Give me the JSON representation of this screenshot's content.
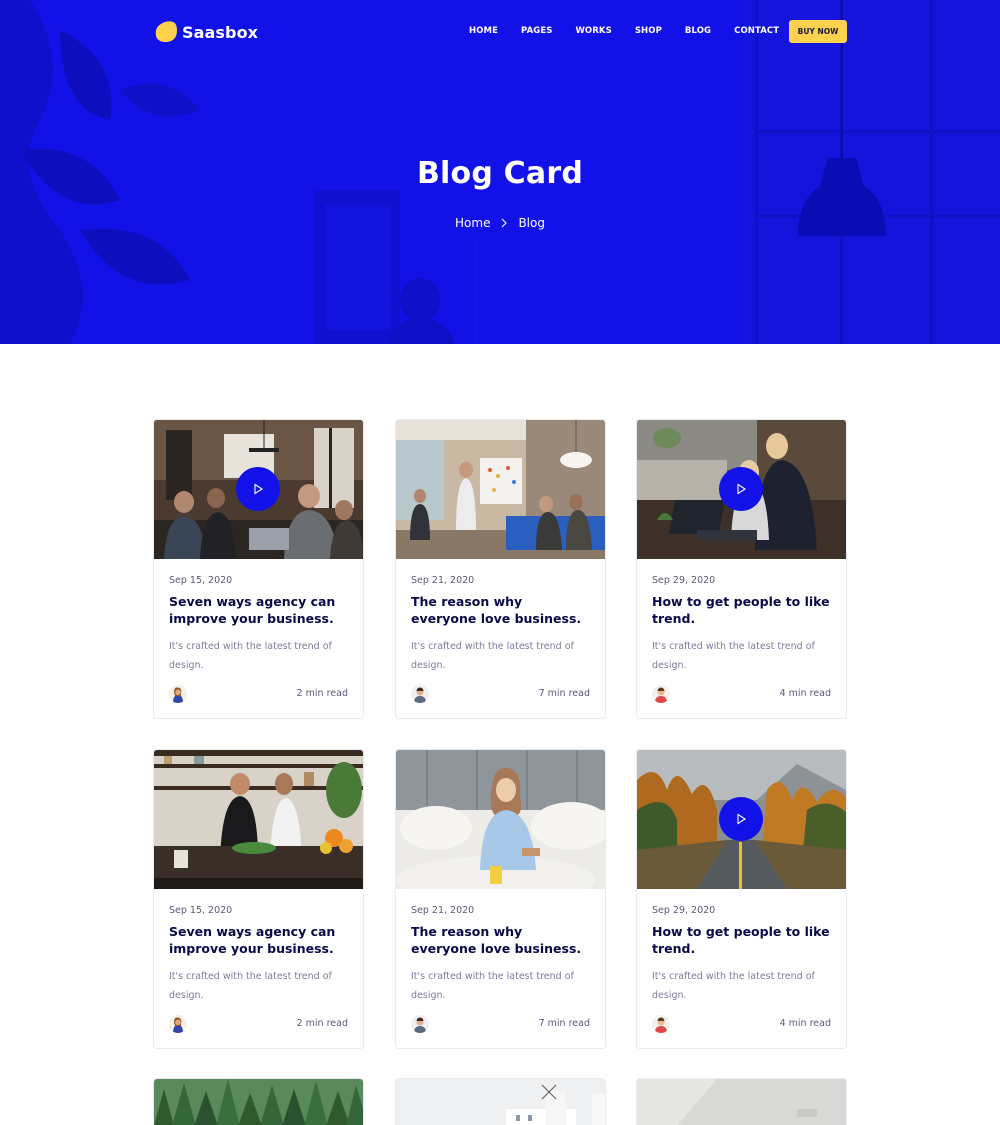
{
  "brand": {
    "name": "Saasbox",
    "logo_color": "#ffd24d",
    "hero_color": "#1212e8"
  },
  "nav": {
    "items": [
      {
        "label": "HOME"
      },
      {
        "label": "PAGES"
      },
      {
        "label": "WORKS"
      },
      {
        "label": "SHOP"
      },
      {
        "label": "BLOG"
      },
      {
        "label": "CONTACT"
      }
    ],
    "cta_label": "BUY NOW"
  },
  "hero": {
    "title": "Blog Card",
    "breadcrumb": [
      "Home",
      "Blog"
    ],
    "separator_icon": "chevron-right-icon"
  },
  "cards": [
    {
      "date": "Sep 15, 2020",
      "title": "Seven ways agency can improve your business.",
      "excerpt": "It's crafted with the latest trend of design.",
      "read_time": "2 min read",
      "has_video": true,
      "image": "team-meeting-photo"
    },
    {
      "date": "Sep 21, 2020",
      "title": "The reason why everyone love business.",
      "excerpt": "It's crafted with the latest trend of design.",
      "read_time": "7 min read",
      "has_video": false,
      "image": "office-presentation-photo"
    },
    {
      "date": "Sep 29, 2020",
      "title": "How to get people to like trend.",
      "excerpt": "It's crafted with the latest trend of design.",
      "read_time": "4 min read",
      "has_video": true,
      "image": "laptop-work-photo"
    },
    {
      "date": "Sep 15, 2020",
      "title": "Seven ways agency can improve your business.",
      "excerpt": "It's crafted with the latest trend of design.",
      "read_time": "2 min read",
      "has_video": false,
      "image": "kitchen-cooking-photo"
    },
    {
      "date": "Sep 21, 2020",
      "title": "The reason why everyone love business.",
      "excerpt": "It's crafted with the latest trend of design.",
      "read_time": "7 min read",
      "has_video": false,
      "image": "woman-in-bed-photo"
    },
    {
      "date": "Sep 29, 2020",
      "title": "How to get people to like trend.",
      "excerpt": "It's crafted with the latest trend of design.",
      "read_time": "4 min read",
      "has_video": true,
      "image": "autumn-road-photo"
    }
  ]
}
